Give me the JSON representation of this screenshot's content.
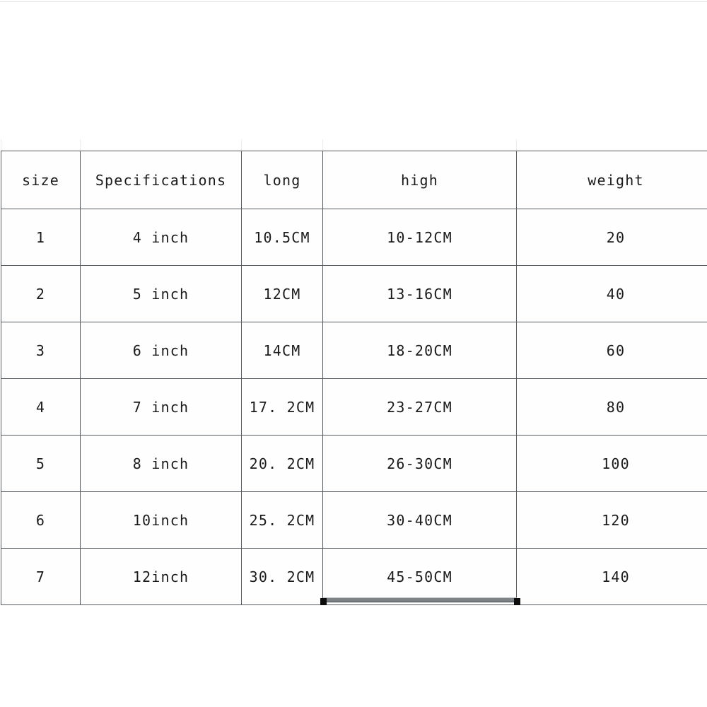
{
  "table": {
    "name": "size-chart",
    "columns": [
      {
        "key": "size",
        "label": "size"
      },
      {
        "key": "spec",
        "label": "Specifications"
      },
      {
        "key": "long",
        "label": "long"
      },
      {
        "key": "high",
        "label": "high"
      },
      {
        "key": "weight",
        "label": "weight"
      }
    ],
    "rows": [
      {
        "size": "1",
        "spec": "4 inch",
        "long": "10.5CM",
        "high": "10-12CM",
        "weight": "20"
      },
      {
        "size": "2",
        "spec": "5 inch",
        "long": "12CM",
        "high": "13-16CM",
        "weight": "40"
      },
      {
        "size": "3",
        "spec": "6 inch",
        "long": "14CM",
        "high": "18-20CM",
        "weight": "60"
      },
      {
        "size": "4",
        "spec": "7 inch",
        "long": "17. 2CM",
        "high": "23-27CM",
        "weight": "80"
      },
      {
        "size": "5",
        "spec": "8 inch",
        "long": "20. 2CM",
        "high": "26-30CM",
        "weight": "100"
      },
      {
        "size": "6",
        "spec": "10inch",
        "long": "25. 2CM",
        "high": "30-40CM",
        "weight": "120"
      },
      {
        "size": "7",
        "spec": "12inch",
        "long": "30. 2CM",
        "high": "45-50CM",
        "weight": "140"
      }
    ]
  },
  "selection": {
    "column": "high",
    "handles": [
      "left",
      "right"
    ]
  },
  "colors": {
    "background": "#ffffff",
    "border": "#555a5e",
    "text": "#1b1b1b",
    "selection": "#7d8286",
    "handle": "#0d0d0d",
    "guide": "#ececec"
  }
}
